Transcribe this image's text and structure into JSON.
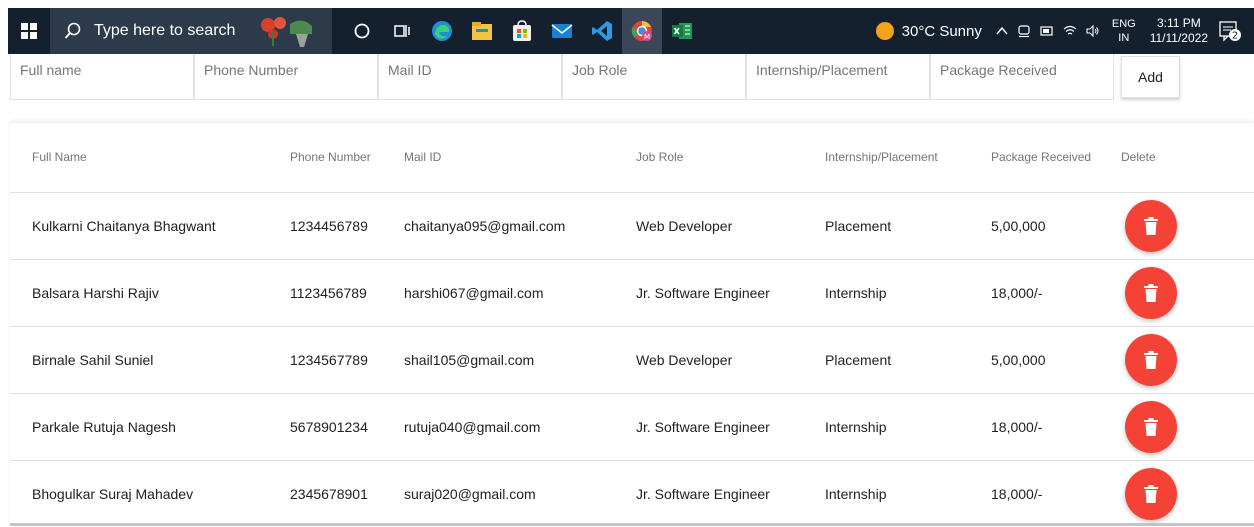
{
  "taskbar": {
    "search_placeholder": "Type here to search",
    "apps": [
      {
        "icon": "cortana-circle-icon"
      },
      {
        "icon": "task-view-icon"
      },
      {
        "icon": "edge-browser-icon"
      },
      {
        "icon": "file-explorer-icon"
      },
      {
        "icon": "microsoft-store-icon"
      },
      {
        "icon": "mail-icon"
      },
      {
        "icon": "vscode-icon"
      },
      {
        "icon": "chrome-icon"
      },
      {
        "icon": "excel-icon"
      }
    ],
    "weather": "30°C  Sunny",
    "lang_top": "ENG",
    "lang_bottom": "IN",
    "time": "3:11 PM",
    "date": "11/11/2022",
    "notification_count": "2"
  },
  "form": {
    "fields": [
      {
        "placeholder": "Full name"
      },
      {
        "placeholder": "Phone Number"
      },
      {
        "placeholder": "Mail ID"
      },
      {
        "placeholder": "Job Role"
      },
      {
        "placeholder": "Internship/Placement"
      },
      {
        "placeholder": "Package Received"
      }
    ],
    "add_label": "Add"
  },
  "table": {
    "headers": [
      "Full Name",
      "Phone Number",
      "Mail ID",
      "Job Role",
      "Internship/Placement",
      "Package Received",
      "Delete"
    ],
    "rows": [
      [
        "Kulkarni Chaitanya Bhagwant",
        "1234456789",
        "chaitanya095@gmail.com",
        "Web Developer",
        "Placement",
        "5,00,000"
      ],
      [
        "Balsara Harshi Rajiv",
        "1123456789",
        "harshi067@gmail.com",
        "Jr. Software Engineer",
        "Internship",
        "18,000/-"
      ],
      [
        "Birnale Sahil Suniel",
        "1234567789",
        "shail105@gmail.com",
        "Web Developer",
        "Placement",
        "5,00,000"
      ],
      [
        "Parkale Rutuja Nagesh",
        "5678901234",
        "rutuja040@gmail.com",
        "Jr. Software Engineer",
        "Internship",
        "18,000/-"
      ],
      [
        "Bhogulkar Suraj Mahadev",
        "2345678901",
        "suraj020@gmail.com",
        "Jr. Software Engineer",
        "Internship",
        "18,000/-"
      ]
    ]
  },
  "colors": {
    "taskbar_bg": "#15202f",
    "delete_button": "#f44336"
  }
}
